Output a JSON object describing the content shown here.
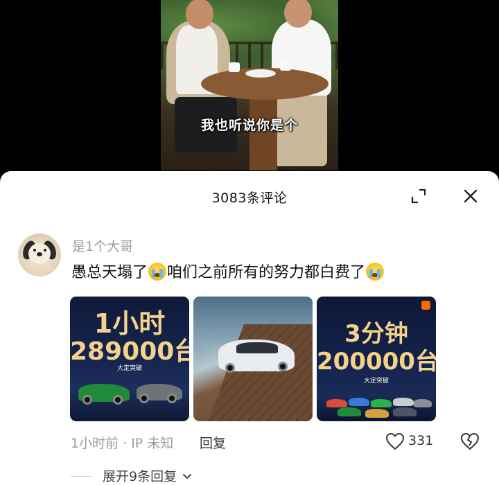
{
  "video": {
    "subtitle": "我也听说你是个"
  },
  "comments_sheet": {
    "title": "3083条评论",
    "expand_icon": "expand-icon",
    "close_icon": "close-icon"
  },
  "comment": {
    "username": "是1个大哥",
    "text_part1": "愚总天塌了",
    "text_part2": "咱们之前所有的努力都白费了",
    "emoji": "loudly-crying-face",
    "images": [
      {
        "line1": "1小时",
        "line2": "289000台",
        "caption": "大定突破"
      },
      {
        "line1": "",
        "line2": "",
        "caption": ""
      },
      {
        "line1": "3分钟",
        "line2": "200000台",
        "caption": "大定突破"
      }
    ],
    "time_ip": "1小时前 · IP 未知",
    "reply_label": "回复",
    "like_count": "331",
    "expand_replies": "展开9条回复"
  },
  "colors": {
    "accent_gold": "#f4d28a",
    "muted_text": "#9a9a9a",
    "background": "#ffffff"
  }
}
